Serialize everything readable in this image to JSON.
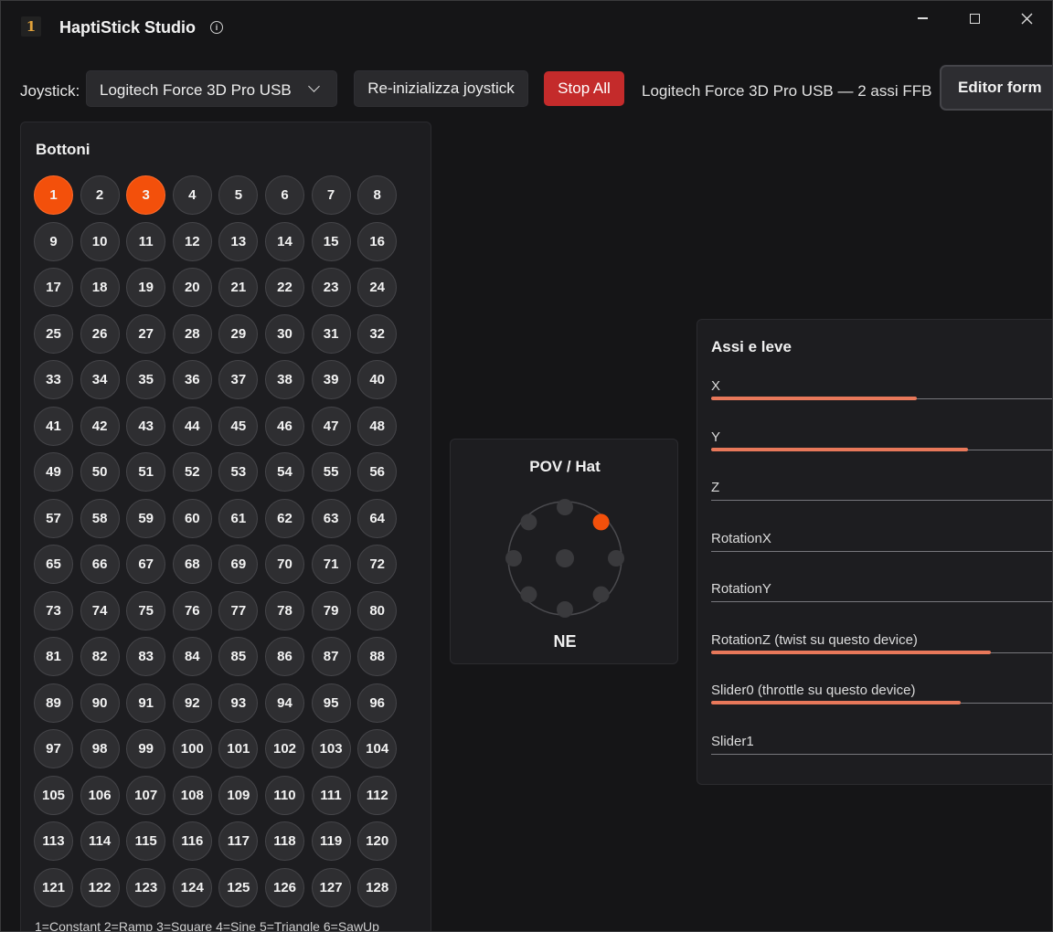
{
  "window": {
    "title": "HaptiStick Studio",
    "icons": {
      "app": "app-logo-icon",
      "info": "info-icon",
      "minimize": "minimize-icon",
      "maximize": "maximize-icon",
      "close": "close-icon"
    }
  },
  "toolbar": {
    "joystick_label": "Joystick:",
    "joystick_selected": "Logitech Force 3D Pro USB",
    "reinit_label": "Re-inizializza joystick",
    "stop_label": "Stop All",
    "device_status": "Logitech Force 3D Pro USB — 2 assi FFB",
    "editor_label": "Editor form"
  },
  "colors": {
    "accent_active": "#f3500b",
    "stop_button": "#c42b2b",
    "axis_fill": "#e8785a",
    "background": "#151517",
    "panel": "#1d1d20"
  },
  "buttons_panel": {
    "title": "Bottoni",
    "count": 128,
    "pressed": [
      1,
      3
    ],
    "effects_legend": "1=Constant 2=Ramp 3=Square 4=Sine 5=Triangle 6=SawUp"
  },
  "pov": {
    "title": "POV / Hat",
    "value": "NE",
    "active_direction": "NE"
  },
  "axes_panel": {
    "title": "Assi e leve",
    "axes": [
      {
        "label": "X",
        "value": 0.6
      },
      {
        "label": "Y",
        "value": 0.75
      },
      {
        "label": "Z",
        "value": 0
      },
      {
        "label": "RotationX",
        "value": 0
      },
      {
        "label": "RotationY",
        "value": 0
      },
      {
        "label": "RotationZ (twist su questo device)",
        "value": 0.815
      },
      {
        "label": "Slider0 (throttle su questo device)",
        "value": 0.727
      },
      {
        "label": "Slider1",
        "value": 0
      }
    ]
  }
}
